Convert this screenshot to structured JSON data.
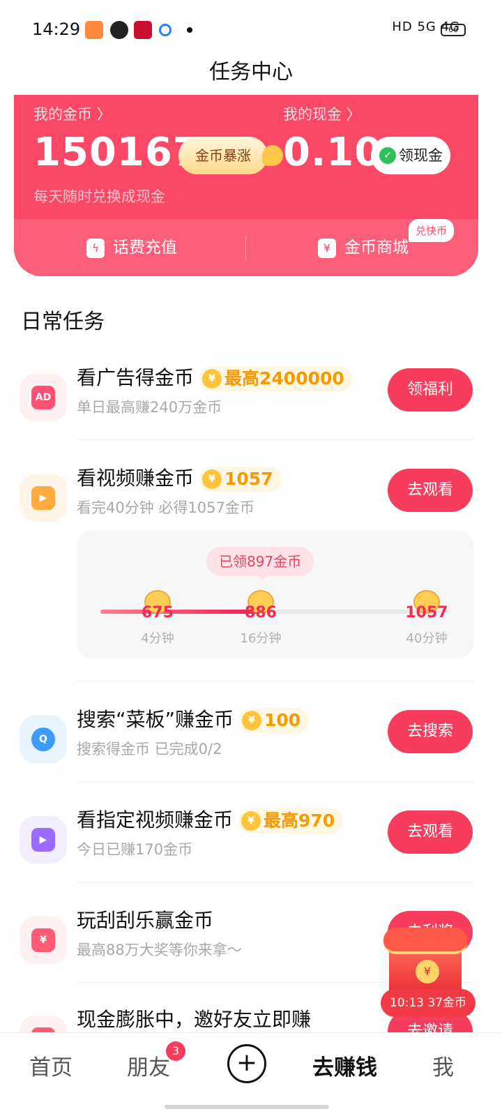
{
  "status_bar": {
    "time": "14:29",
    "right_text": "HD 5G 4G",
    "battery": "66"
  },
  "header": {
    "title": "任务中心"
  },
  "coin_card": {
    "coins_label": "我的金币 〉",
    "coins_value": "150167",
    "coins_badge": "金币暴涨",
    "cash_label": "我的现金 〉",
    "cash_value": "0.10",
    "cash_button": "领现金",
    "subtitle": "每天随时兑换成现金",
    "phone_recharge": "话费充值",
    "coin_mall": "金币商城",
    "mall_tag": "兑快币"
  },
  "section_title": "日常任务",
  "tasks": [
    {
      "title": "看广告得金币",
      "coin_tag": "最高2400000",
      "subtitle": "单日最高赚240万金币",
      "button": "领福利",
      "icon": "ad-icon",
      "icon_text": "AD"
    },
    {
      "title": "看视频赚金币",
      "coin_tag": "1057",
      "subtitle": "看完40分钟 必得1057金币",
      "button": "去观看",
      "icon": "video-camera-icon"
    },
    {
      "title": "搜索“菜板”赚金币",
      "coin_tag": "100",
      "subtitle": "搜索得金币 已完成0/2",
      "button": "去搜索",
      "icon": "search-icon"
    },
    {
      "title": "看指定视频赚金币",
      "coin_tag": "最高970",
      "subtitle": "今日已赚170金币",
      "button": "去观看",
      "icon": "play-icon"
    },
    {
      "title": "玩刮刮乐赢金币",
      "subtitle": "最高88万大奖等你来拿～",
      "button": "去刮奖",
      "icon": "scratch-card-icon"
    },
    {
      "title": "现金膨胀中，邀好友立即赚",
      "button": "去邀请",
      "icon": "invite-icon"
    }
  ],
  "video_progress": {
    "claimed_bubble": "已领897金币",
    "progress_fraction": 0.47,
    "milestones": [
      {
        "coins": "675",
        "time": "4分钟"
      },
      {
        "coins": "886",
        "time": "16分钟"
      },
      {
        "coins": "1057",
        "time": "40分钟"
      }
    ]
  },
  "floating_packet": {
    "timer_text": "10:13 37金币",
    "coin_glyph": "¥"
  },
  "bottom_nav": {
    "home": "首页",
    "friends": "朋友",
    "friends_badge": "3",
    "plus": "+",
    "earn": "去赚钱",
    "me": "我"
  },
  "colors": {
    "primary": "#f83c5e",
    "card": "#fb4866",
    "coin": "#f59a00"
  }
}
